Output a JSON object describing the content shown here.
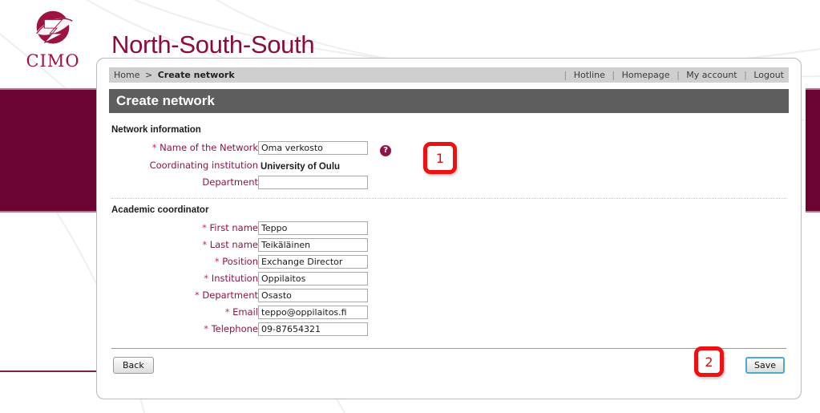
{
  "brand": {
    "logo_icon": "cimo-globe-z-logo",
    "logo_word": "CIMO",
    "site_title": "North-South-South",
    "maroon": "#6b0430",
    "accent": "#8d1446",
    "label_color": "#8d1446",
    "asterisk_color": "#cf1e7a",
    "header_bar_color": "#5e5e5e",
    "annotation_color": "#ee1111",
    "save_focus_border": "#4fa9d6"
  },
  "breadcrumb": {
    "home": "Home",
    "separator": ">",
    "current": "Create network"
  },
  "top_links": [
    {
      "label": "Hotline"
    },
    {
      "label": "Homepage"
    },
    {
      "label": "My account"
    },
    {
      "label": "Logout"
    }
  ],
  "page": {
    "title": "Create network"
  },
  "sections": [
    {
      "title": "Network information",
      "fields": [
        {
          "label": "Name of the Network",
          "required": true,
          "type": "input",
          "value": "Oma verkosto",
          "placeholder": "",
          "help_icon": "question-mark-icon",
          "name": "name-of-the-network"
        },
        {
          "label": "Coordinating institution",
          "required": false,
          "type": "static",
          "value": "University of Oulu",
          "name": "coordinating-institution"
        },
        {
          "label": "Department",
          "required": false,
          "type": "input",
          "value": "",
          "placeholder": "",
          "name": "network-department"
        }
      ]
    },
    {
      "title": "Academic coordinator",
      "fields": [
        {
          "label": "First name",
          "required": true,
          "type": "input",
          "value": "Teppo",
          "placeholder": "",
          "name": "first-name"
        },
        {
          "label": "Last name",
          "required": true,
          "type": "input",
          "value": "Teikäläinen",
          "placeholder": "",
          "name": "last-name"
        },
        {
          "label": "Position",
          "required": true,
          "type": "input",
          "value": "Exchange Director",
          "placeholder": "",
          "name": "position"
        },
        {
          "label": "Institution",
          "required": true,
          "type": "input",
          "value": "Oppilaitos",
          "placeholder": "",
          "name": "institution"
        },
        {
          "label": "Department",
          "required": true,
          "type": "input",
          "value": "Osasto",
          "placeholder": "",
          "name": "coordinator-department"
        },
        {
          "label": "Email",
          "required": true,
          "type": "input",
          "value": "teppo@oppilaitos.fi",
          "placeholder": "",
          "name": "email"
        },
        {
          "label": "Telephone",
          "required": true,
          "type": "input",
          "value": "09-87654321",
          "placeholder": "",
          "name": "telephone"
        }
      ]
    }
  ],
  "buttons": {
    "back_label": "Back",
    "save_label": "Save"
  },
  "annotations": [
    {
      "number": "1"
    },
    {
      "number": "2"
    }
  ]
}
